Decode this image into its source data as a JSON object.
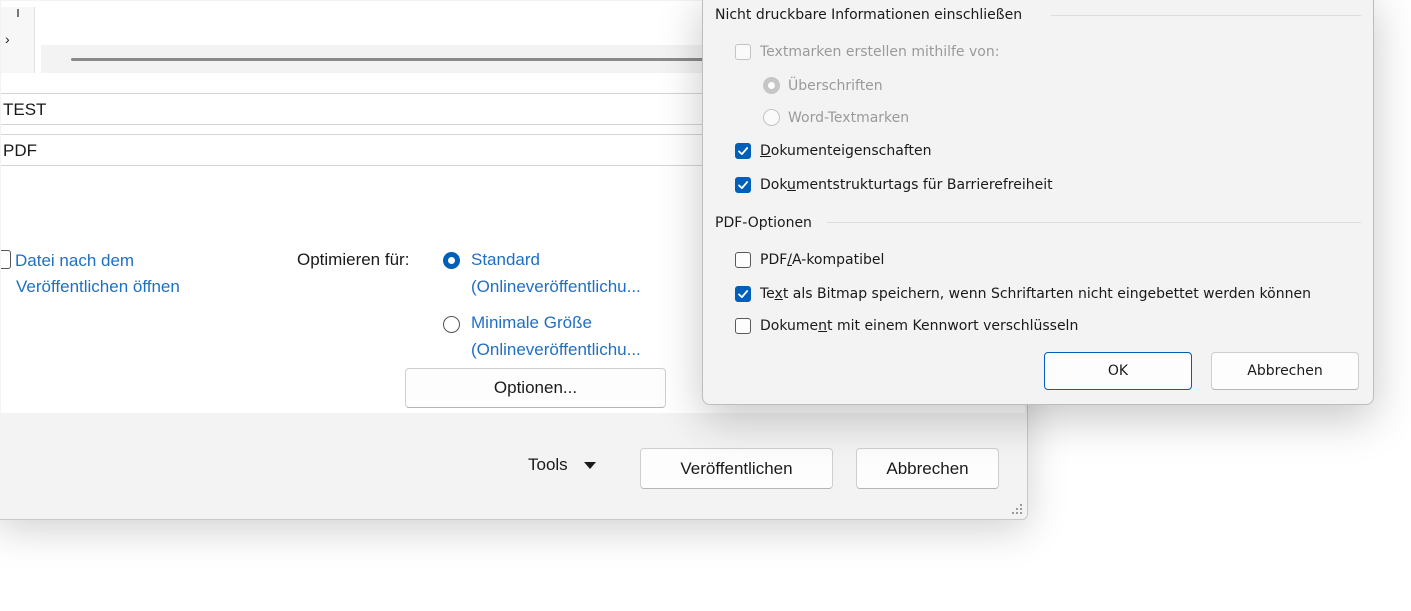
{
  "back_dialog": {
    "preview_left_glyph": "›",
    "file_name": "TEST",
    "file_type": "PDF",
    "open_after_line1": "Datei nach dem",
    "open_after_line2": "Veröffentlichen öffnen",
    "optimize_label": "Optimieren für:",
    "optimize_options": [
      {
        "line1": "Standard",
        "line2": "(Onlineveröffentlichu...",
        "selected": true
      },
      {
        "line1": "Minimale Größe",
        "line2": "(Onlineveröffentlichu...",
        "selected": false
      }
    ],
    "options_button": "Optionen...",
    "tools_label": "Tools",
    "publish_button": "Veröffentlichen",
    "cancel_button": "Abbrechen"
  },
  "options_dialog": {
    "nonprint_group_label": "Nicht druckbare Informationen einschließen",
    "bookmarks": {
      "label": "Textmarken erstellen mithilfe von:",
      "checked": false,
      "enabled": false
    },
    "bookmark_sources": [
      {
        "label": "Überschriften",
        "selected": true
      },
      {
        "label": "Word-Textmarken",
        "selected": false
      }
    ],
    "doc_properties": {
      "u": "D",
      "rest": "okumenteigenschaften",
      "checked": true
    },
    "structure_tags": {
      "pre": "Dok",
      "u": "u",
      "rest": "mentstrukturtags für Barrierefreiheit",
      "checked": true
    },
    "pdf_group_label": "PDF-Optionen",
    "pdfa": {
      "pre": "PDF",
      "u": "/",
      "rest": "A-kompatibel",
      "checked": false
    },
    "bitmap_text": {
      "pre": "Te",
      "u": "x",
      "rest": "t als Bitmap speichern, wenn Schriftarten nicht eingebettet werden können",
      "checked": true
    },
    "encrypt": {
      "pre": "Dokume",
      "u": "n",
      "rest": "t mit einem Kennwort verschlüsseln",
      "checked": false
    },
    "ok_button": "OK",
    "cancel_button": "Abbrechen"
  },
  "colors": {
    "accent": "#005fb8",
    "link": "#1f6fc5",
    "disabled": "#9a9a9a"
  },
  "icons": [
    "checkmark-icon",
    "dropdown-caret-icon",
    "resize-grip-icon"
  ]
}
